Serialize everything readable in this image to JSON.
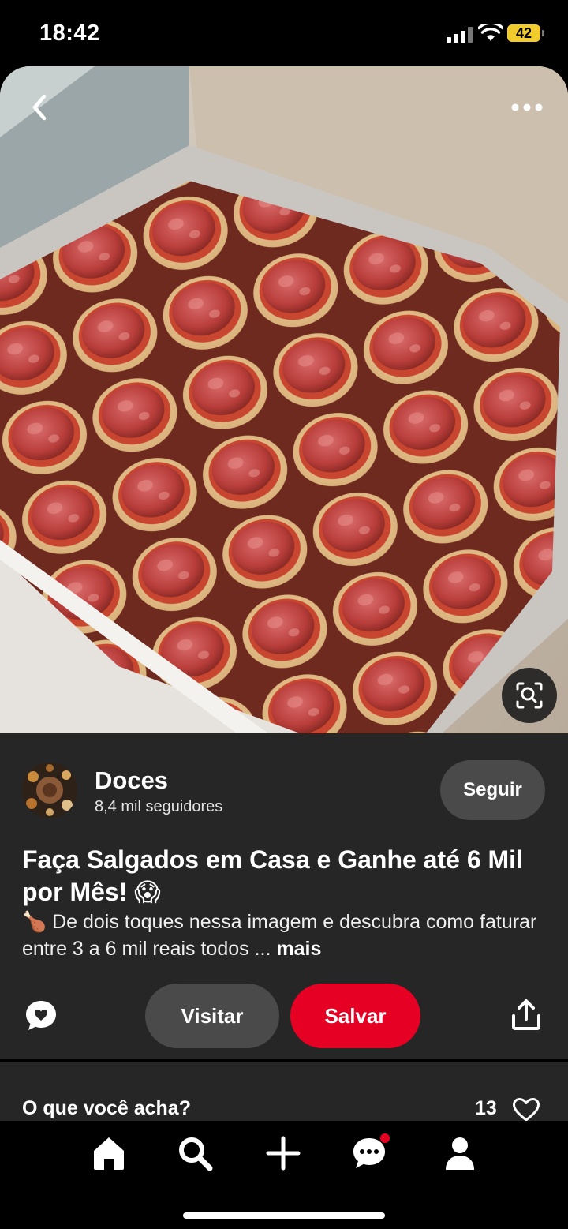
{
  "status_bar": {
    "time": "18:42",
    "battery": "42"
  },
  "author": {
    "name": "Doces",
    "followers": "8,4 mil seguidores",
    "follow_label": "Seguir"
  },
  "pin": {
    "title": "Faça Salgados em Casa e Ganhe até 6 Mil por Mês! 😱",
    "description": "🍗 De dois toques nessa imagem e descubra como faturar entre 3 a 6 mil reais todos ...",
    "more_label": "mais"
  },
  "actions": {
    "visit_label": "Visitar",
    "save_label": "Salvar"
  },
  "comments": {
    "prompt": "O que você acha?",
    "likes": "13"
  },
  "icons": {
    "back": "chevron-left-icon",
    "more": "ellipsis-icon",
    "lens": "visual-search-icon",
    "comment": "comment-bubble-icon",
    "share": "share-icon",
    "heart": "heart-outline-icon",
    "nav": [
      "home-icon",
      "search-icon",
      "plus-icon",
      "chat-icon",
      "profile-icon"
    ]
  },
  "colors": {
    "save_button": "#e60023",
    "panel_bg": "#262626",
    "button_grey": "#4a4a4a",
    "battery": "#f2cc2c"
  }
}
